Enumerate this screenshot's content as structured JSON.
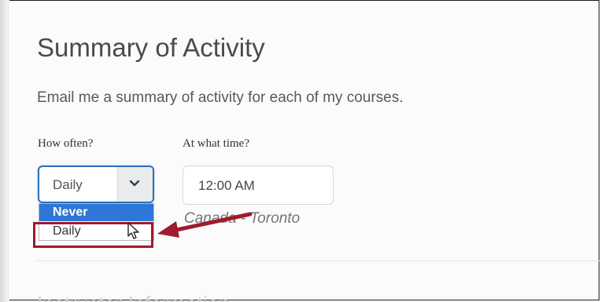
{
  "section": {
    "title": "Summary of Activity",
    "description": "Email me a summary of activity for each of my courses."
  },
  "frequency": {
    "label": "How often?",
    "selected": "Daily",
    "options": [
      "Never",
      "Daily"
    ]
  },
  "time": {
    "label": "At what time?",
    "value": "12:00 AM",
    "timezone": "Canada - Toronto"
  },
  "next_section": {
    "title": "Instructor Information"
  },
  "colors": {
    "focus_border": "#2d6fb5",
    "option_highlight": "#2f77d6",
    "annotation": "#9e1b2b"
  },
  "icons": {
    "select_arrow": "chevron-down-icon",
    "pointer": "mouse-cursor-icon",
    "annotation_arrow": "arrow-icon"
  }
}
